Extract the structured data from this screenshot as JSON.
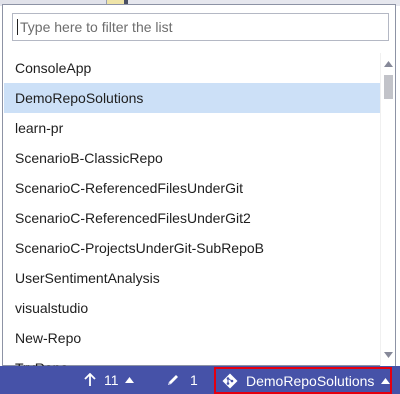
{
  "filter": {
    "placeholder": "Type here to filter the list",
    "value": ""
  },
  "repo_list": {
    "selected_index": 1,
    "items": [
      "ConsoleApp",
      "DemoRepoSolutions",
      "learn-pr",
      "ScenarioB-ClassicRepo",
      "ScenarioC-ReferencedFilesUnderGit",
      "ScenarioC-ReferencedFilesUnderGit2",
      "ScenarioC-ProjectsUnderGit-SubRepoB",
      "UserSentimentAnalysis",
      "visualstudio",
      "New-Repo",
      "TryRepo"
    ]
  },
  "status_bar": {
    "push_count": "11",
    "pending_changes": "1",
    "current_repo": "DemoRepoSolutions",
    "icons": {
      "push": "up-arrow-icon",
      "changes": "pencil-icon",
      "repo": "git-diamond-icon",
      "expand": "triangle-up-icon"
    }
  },
  "colors": {
    "status_bar_bg": "#4652a8",
    "selected_row_bg": "#cce0f7",
    "highlight_border": "#e4000f"
  }
}
